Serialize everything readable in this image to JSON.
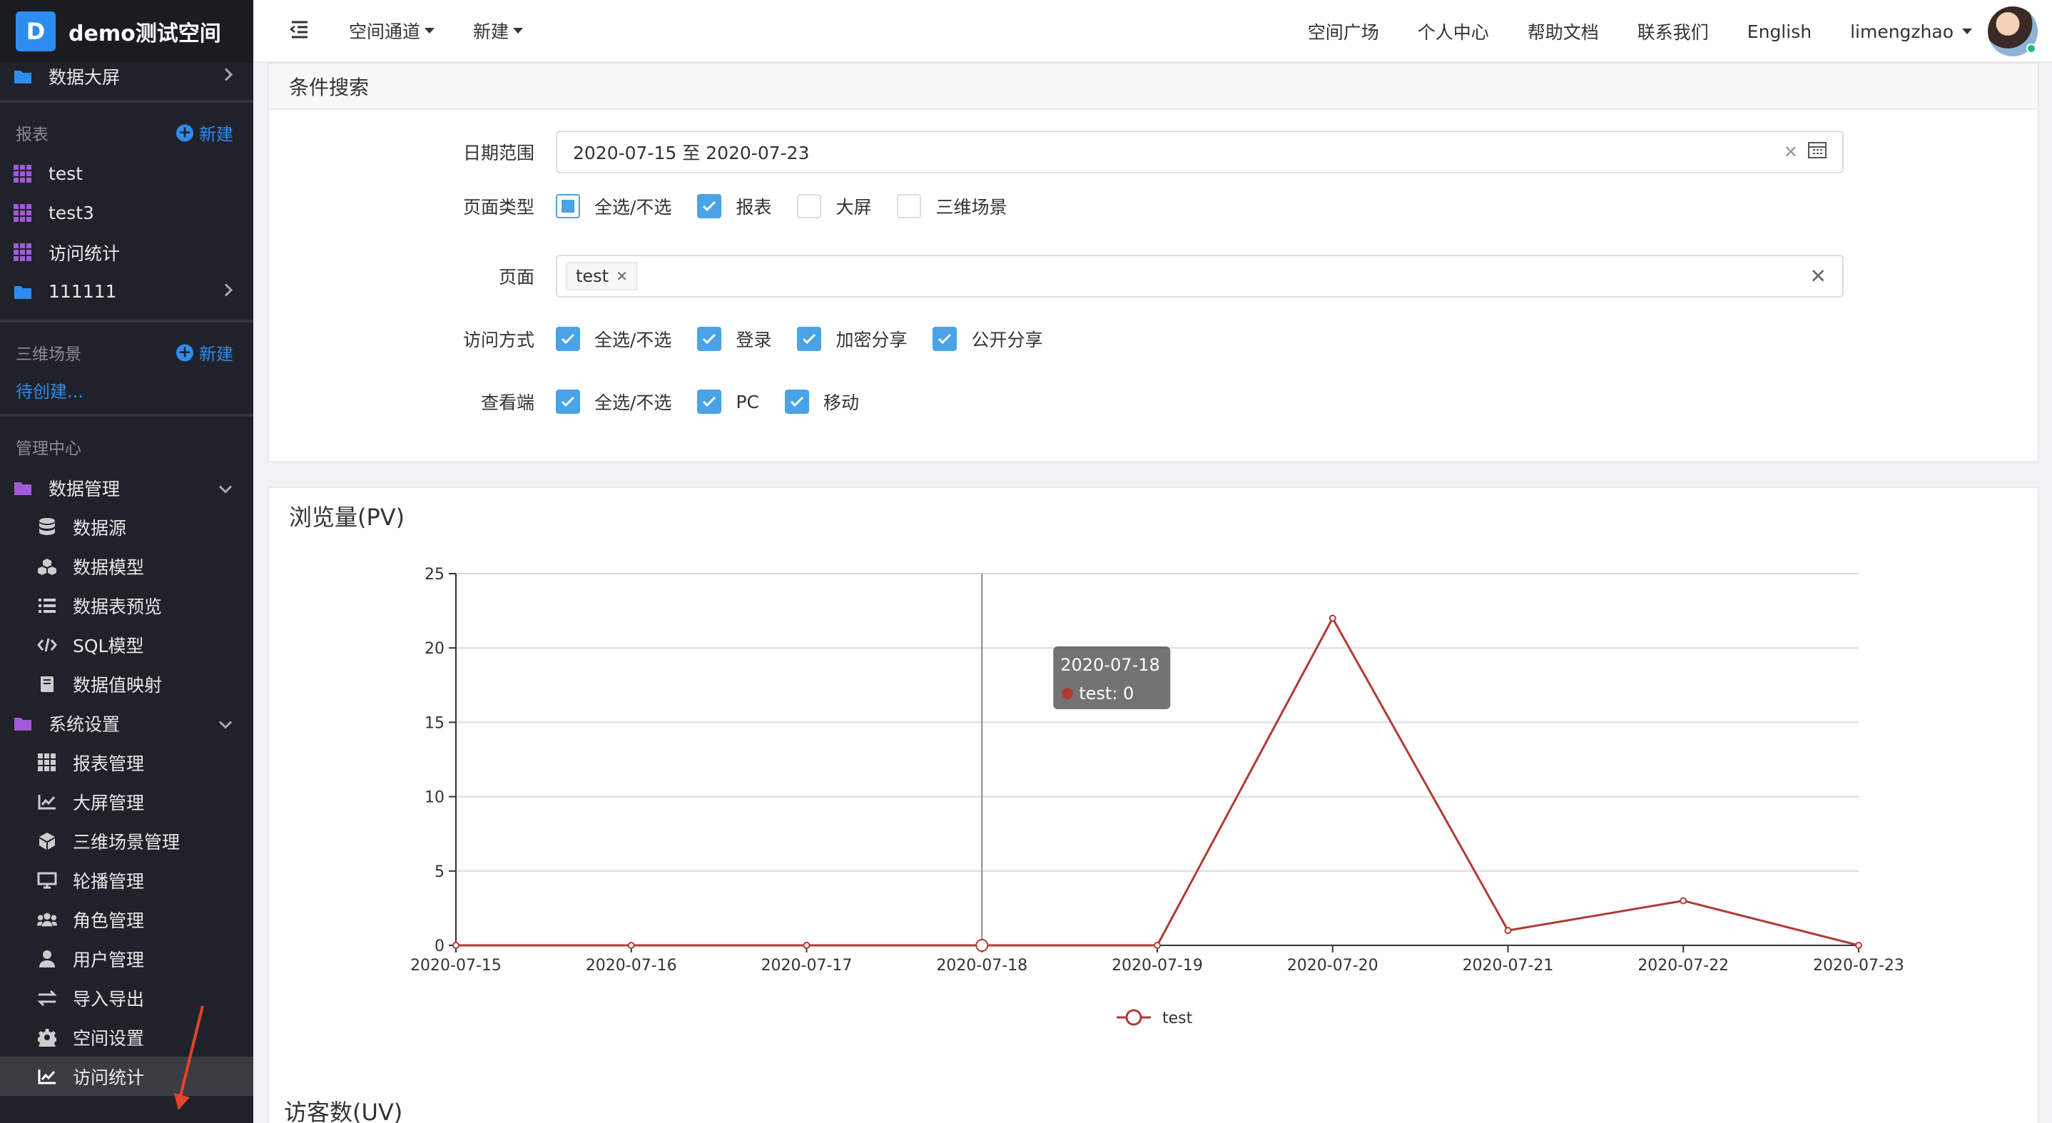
{
  "brand": {
    "logo_letter": "D",
    "name": "demo测试空间"
  },
  "sidebar": {
    "dashboard_folder": "数据大屏",
    "reports_section": {
      "title": "报表",
      "new_label": "新建"
    },
    "reports": [
      "test",
      "test3",
      "访问统计",
      "111111"
    ],
    "scene_section": {
      "title": "三维场景",
      "new_label": "新建",
      "pending": "待创建..."
    },
    "admin_section": {
      "title": "管理中心"
    },
    "data_mgmt": {
      "label": "数据管理",
      "items": [
        "数据源",
        "数据模型",
        "数据表预览",
        "SQL模型",
        "数据值映射"
      ]
    },
    "system_settings": {
      "label": "系统设置",
      "items": [
        "报表管理",
        "大屏管理",
        "三维场景管理",
        "轮播管理",
        "角色管理",
        "用户管理",
        "导入导出",
        "空间设置",
        "访问统计"
      ]
    }
  },
  "header": {
    "menus": [
      "空间通道",
      "新建"
    ],
    "links": [
      "空间广场",
      "个人中心",
      "帮助文档",
      "联系我们",
      "English"
    ],
    "user": "limengzhao"
  },
  "search": {
    "title": "条件搜索",
    "date_label": "日期范围",
    "date_value": "2020-07-15 至 2020-07-23",
    "page_type_label": "页面类型",
    "page_type_options": [
      {
        "label": "全选/不选",
        "state": "indeterminate"
      },
      {
        "label": "报表",
        "state": "checked"
      },
      {
        "label": "大屏",
        "state": "unchecked"
      },
      {
        "label": "三维场景",
        "state": "unchecked"
      }
    ],
    "page_label": "页面",
    "page_tag": "test",
    "access_label": "访问方式",
    "access_options": [
      {
        "label": "全选/不选",
        "state": "checked"
      },
      {
        "label": "登录",
        "state": "checked"
      },
      {
        "label": "加密分享",
        "state": "checked"
      },
      {
        "label": "公开分享",
        "state": "checked"
      }
    ],
    "viewer_label": "查看端",
    "viewer_options": [
      {
        "label": "全选/不选",
        "state": "checked"
      },
      {
        "label": "PC",
        "state": "checked"
      },
      {
        "label": "移动",
        "state": "checked"
      }
    ]
  },
  "pv_title": "浏览量(PV)",
  "uv_title": "访客数(UV)",
  "chart_data": {
    "type": "line",
    "title": "浏览量(PV)",
    "categories": [
      "2020-07-15",
      "2020-07-16",
      "2020-07-17",
      "2020-07-18",
      "2020-07-19",
      "2020-07-20",
      "2020-07-21",
      "2020-07-22",
      "2020-07-23"
    ],
    "series": [
      {
        "name": "test",
        "values": [
          0,
          0,
          0,
          0,
          0,
          22,
          1,
          3,
          0
        ],
        "color": "#b03a36"
      }
    ],
    "ylim": [
      0,
      25
    ],
    "yticks": [
      0,
      5,
      10,
      15,
      20,
      25
    ],
    "grid": true,
    "legend": "bottom-center",
    "tooltip": {
      "category": "2020-07-18",
      "series": "test",
      "value": 0,
      "text": "test: 0"
    }
  },
  "colors": {
    "accent": "#2d8cf0",
    "sidebar_bg": "#1f2229",
    "series": "#b03a36",
    "annotation": "#e8412c"
  }
}
